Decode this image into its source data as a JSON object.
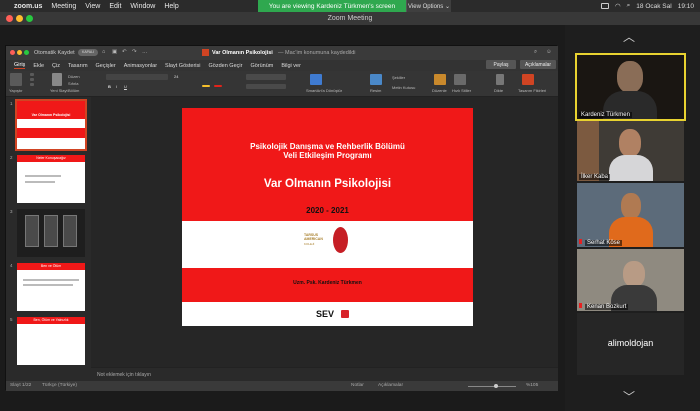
{
  "menubar": {
    "app": "zoom.us",
    "items": [
      "Meeting",
      "View",
      "Edit",
      "Window",
      "Help"
    ],
    "date": "18 Ocak Sal",
    "time": "19:10"
  },
  "banner": {
    "text": "You are viewing Kardeniz Türkmen's screen",
    "view_options": "View Options ⌄"
  },
  "window": {
    "title": "Zoom Meeting"
  },
  "ppt": {
    "autosave": "Otomatik Kaydet",
    "autosave_state": "KAPALI",
    "doc_title": "Var Olmanın Psikolojisi",
    "doc_saved": "— Mac'im konumuna kaydedildi",
    "tabs": [
      "Giriş",
      "Ekle",
      "Çiz",
      "Tasarım",
      "Geçişler",
      "Animasyonlar",
      "Slayt Gösterisi",
      "Gözden Geçir",
      "Görünüm",
      "Bilgi ver"
    ],
    "share": "Paylaş",
    "comments": "Açıklamalar",
    "ribbon": {
      "paste": "Yapıştır",
      "new_slide": "Yeni Slayt",
      "layout": "Düzen",
      "reset": "Sıfırla",
      "section": "Bölüm",
      "font_size": "24",
      "smartart": "SmartArt'a Dönüştür",
      "picture": "Resim",
      "shapes": "Şekiller",
      "textbox": "Metin Kutusu",
      "arrange": "Düzenle",
      "quick_styles": "Hızlı Stiller",
      "dictate": "Dikte",
      "designer": "Tasarım Fikirleri"
    },
    "slide": {
      "line1": "Psikolojik Danışma ve Rehberlik Bölümü",
      "line2": "Veli Etkileşim Programı",
      "title": "Var Olmanın Psikolojisi",
      "years": "2020 - 2021",
      "logo_name": "TARSUS AMERICAN",
      "logo_sub": "KOLEJİ",
      "author": "Uzm. Psk. Kardeniz Türkmen",
      "sev": "SEV"
    },
    "thumbs": [
      {
        "num": "1",
        "title": "Var Olmanın Psikolojisi"
      },
      {
        "num": "2",
        "title": "Neler Konuşacağız"
      },
      {
        "num": "3",
        "title": ""
      },
      {
        "num": "4",
        "title": "Ben ve Ölüm"
      },
      {
        "num": "5",
        "title": "Ben, Ölüm ve Yalnızlık"
      }
    ],
    "notes": "Not eklemek için tıklayın",
    "status_slide": "Slayt 1/22",
    "status_lang": "Türkçe (Türkiye)",
    "status_notes": "Notlar",
    "status_comments": "Açıklamalar",
    "zoom": "%105"
  },
  "participants": [
    {
      "name": "Kardeniz Türkmen",
      "active": true
    },
    {
      "name": "İlker Kaba",
      "active": false
    },
    {
      "name": "Serhat Köse",
      "active": false
    },
    {
      "name": "Kenan Bozkurt",
      "active": false
    },
    {
      "name": "alimoldojan",
      "active": false
    }
  ],
  "colors": {
    "slide_red": "#f01818",
    "active_speaker": "#e8d230",
    "banner_green": "#2fa84f",
    "ppt_accent": "#d04423"
  }
}
